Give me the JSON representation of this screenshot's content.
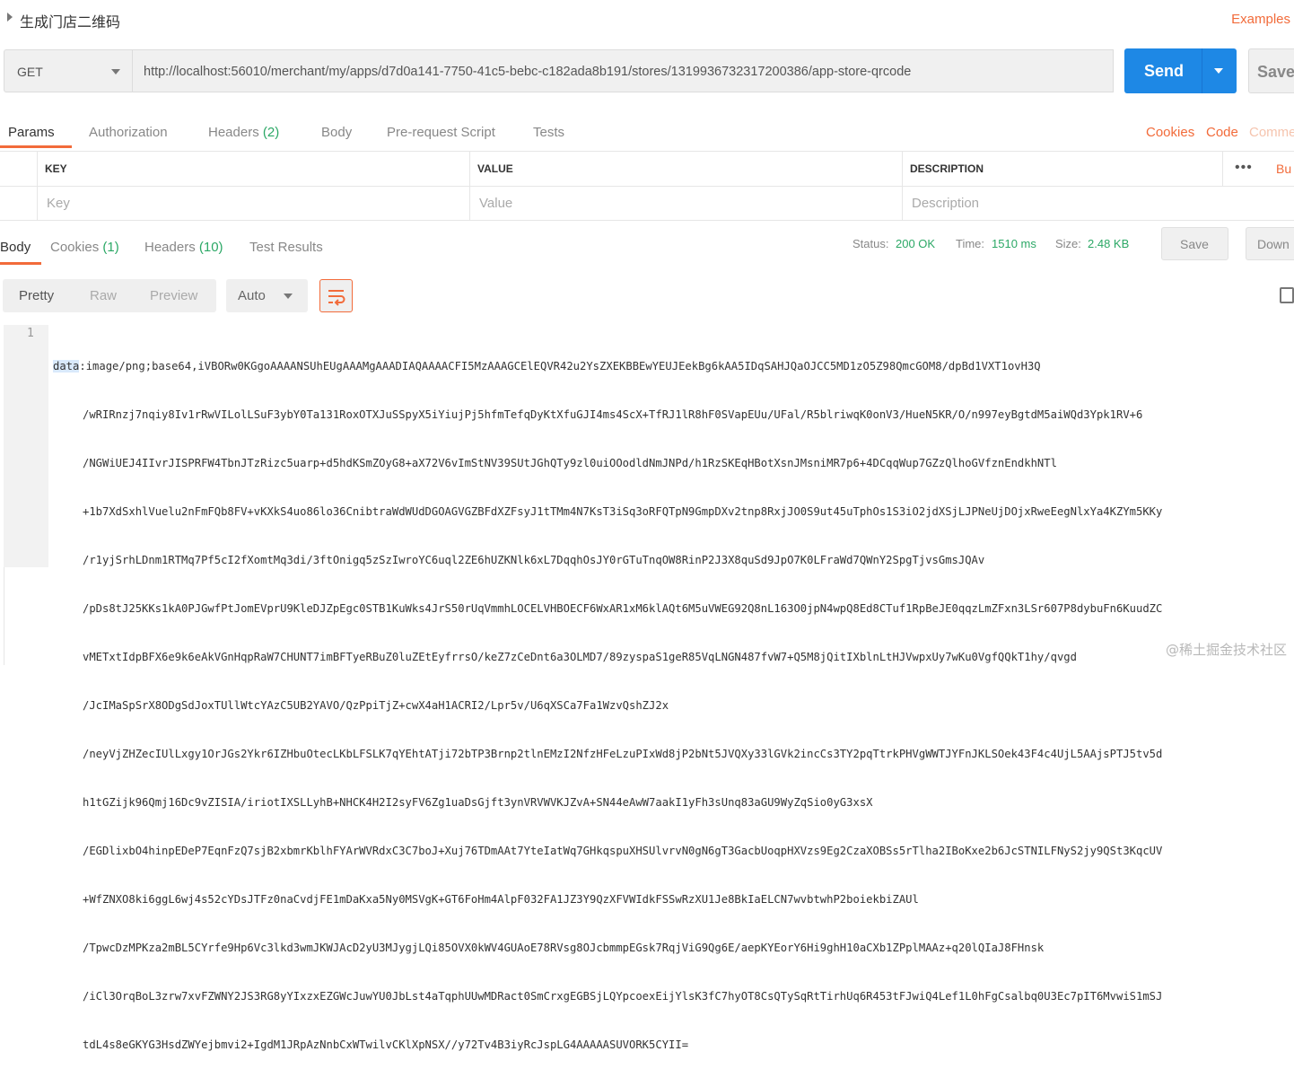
{
  "request": {
    "title": "生成门店二维码",
    "examples_label": "Examples",
    "method": "GET",
    "url": "http://localhost:56010/merchant/my/apps/d7d0a141-7750-41c5-bebc-c182ada8b191/stores/1319936732317200386/app-store-qrcode",
    "send_label": "Send",
    "save_label": "Save"
  },
  "request_tabs": {
    "params": "Params",
    "authorization": "Authorization",
    "headers": "Headers",
    "headers_count": "(2)",
    "body": "Body",
    "prerequest": "Pre-request Script",
    "tests": "Tests",
    "cookies": "Cookies",
    "code": "Code",
    "comments": "Comme"
  },
  "params_table": {
    "col_key": "KEY",
    "col_value": "VALUE",
    "col_description": "DESCRIPTION",
    "more": "•••",
    "bulk_edit": "Bu",
    "key_placeholder": "Key",
    "value_placeholder": "Value",
    "description_placeholder": "Description"
  },
  "response_tabs": {
    "body": "Body",
    "cookies": "Cookies",
    "cookies_count": "(1)",
    "headers": "Headers",
    "headers_count": "(10)",
    "test_results": "Test Results"
  },
  "response_meta": {
    "status_label": "Status:",
    "status_value": "200 OK",
    "time_label": "Time:",
    "time_value": "1510 ms",
    "size_label": "Size:",
    "size_value": "2.48 KB",
    "save_label": "Save",
    "download_label": "Down"
  },
  "view": {
    "pretty": "Pretty",
    "raw": "Raw",
    "preview": "Preview",
    "format": "Auto"
  },
  "code": {
    "line_number": "1",
    "first_hl": "data",
    "first_rest": ":image/png;base64,iVBORw0KGgoAAAANSUhEUgAAAMgAAADIAQAAAACFI5MzAAAGCElEQVR42u2YsZXEKBBEwYEUJEekBg6kAA5IDqSAHJQaOJCC5MD1zO5Z98QmcGOM8/dpBd1VXT1ovH3Q",
    "lines": [
      "/wRIRnzj7nqiy8Iv1rRwVILolLSuF3ybY0Ta131RoxOTXJuSSpyX5iYiujPj5hfmTefqDyKtXfuGJI4ms4ScX+TfRJ1lR8hF0SVapEUu/UFal/R5blriwqK0onV3/HueN5KR/O/n997eyBgtdM5aiWQd3Ypk1RV+6",
      "/NGWiUEJ4IIvrJISPRFW4TbnJTzRizc5uarp+d5hdKSmZOyG8+aX72V6vImStNV39SUtJGhQTy9zl0uiOOodldNmJNPd/h1RzSKEqHBotXsnJMsniMR7p6+4DCqqWup7GZzQlhoGVfznEndkhNTl",
      "+1b7XdSxhlVuelu2nFmFQb8FV+vKXkS4uo86lo36CnibtraWdWUdDGOAGVGZBFdXZFsyJ1tTMm4N7KsT3iSq3oRFQTpN9GmpDXv2tnp8RxjJO0S9ut45uTphOs1S3iO2jdXSjLJPNeUjDOjxRweEegNlxYa4KZYm5KKy",
      "/r1yjSrhLDnm1RTMq7Pf5cI2fXomtMq3di/3ftOnigq5zSzIwroYC6uql2ZE6hUZKNlk6xL7DqqhOsJY0rGTuTnqOW8RinP2J3X8quSd9JpO7K0LFraWd7QWnY2SpgTjvsGmsJQAv",
      "/pDs8tJ25KKs1kA0PJGwfPtJomEVprU9KleDJZpEgc0STB1KuWks4JrS50rUqVmmhLOCELVHBOECF6WxAR1xM6klAQt6M5uVWEG92Q8nL163O0jpN4wpQ8Ed8CTuf1RpBeJE0qqzLmZFxn3LSr607P8dybuFn6KuudZC",
      "vMETxtIdpBFX6e9k6eAkVGnHqpRaW7CHUNT7imBFTyeRBuZ0luZEtEyfrrsO/keZ7zCeDnt6a3OLMD7/89zyspaS1geR85VqLNGN487fvW7+Q5M8jQitIXblnLtHJVwpxUy7wKu0VgfQQkT1hy/qvgd",
      "/JcIMaSpSrX8ODgSdJoxTUllWtcYAzC5UB2YAVO/QzPpiTjZ+cwX4aH1ACRI2/Lpr5v/U6qXSCa7Fa1WzvQshZJ2x",
      "/neyVjZHZecIUlLxgy1OrJGs2Ykr6IZHbuOtecLKbLFSLK7qYEhtATji72bTP3Brnp2tlnEMzI2NfzHFeLzuPIxWd8jP2bNt5JVQXy33lGVk2incCs3TY2pqTtrkPHVgWWTJYFnJKLSOek43F4c4UjL5AAjsPTJ5tv5d",
      "h1tGZijk96Qmj16Dc9vZISIA/iriotIXSLLyhB+NHCK4H2I2syFV6Zg1uaDsGjft3ynVRVWVKJZvA+SN44eAwW7aakI1yFh3sUnq83aGU9WyZqSio0yG3xsX",
      "/EGDlixbO4hinpEDeP7EqnFzQ7sjB2xbmrKblhFYArWVRdxC3C7boJ+Xuj76TDmAAt7YteIatWq7GHkqspuXHSUlvrvN0gN6gT3GacbUoqpHXVzs9Eg2CzaXOBSs5rTlha2IBoKxe2b6JcSTNILFNyS2jy9QSt3KqcUV",
      "+WfZNXO8ki6ggL6wj4s52cYDsJTFz0naCvdjFE1mDaKxa5Ny0MSVgK+GT6FoHm4AlpF032FA1JZ3Y9QzXFVWIdkFSSwRzXU1Je8BkIaELCN7wvbtwhP2boiekbiZAUl",
      "/TpwcDzMPKza2mBL5CYrfe9Hp6Vc3lkd3wmJKWJAcD2yU3MJygjLQi85OVX0kWV4GUAoE78RVsg8OJcbmmpEGsk7RqjViG9Qg6E/aepKYEorY6Hi9ghH10aCXb1ZPplMAAz+q20lQIaJ8FHnsk",
      "/iCl3OrqBoL3zrw7xvFZWNY2JS3RG8yYIxzxEZGWcJuwYU0JbLst4aTqphUUwMDRact0SmCrxgEGBSjLQYpcoexEijYlsK3fC7hyOT8CsQTySqRtTirhUq6R453tFJwiQ4Lef1L0hFgCsalbq0U3Ec7pIT6MvwiS1mSJ",
      "tdL4s8eGKYG3HsdZWYejbmvi2+IgdM1JRpAzNnbCxWTwilvCKlXpNSX//y72Tv4B3iyRcJspLG4AAAAASUVORK5CYII="
    ]
  },
  "watermark": "@稀土掘金技术社区",
  "colors": {
    "accent": "#f26b3a",
    "send": "#1e88e5",
    "success": "#2ca866"
  }
}
